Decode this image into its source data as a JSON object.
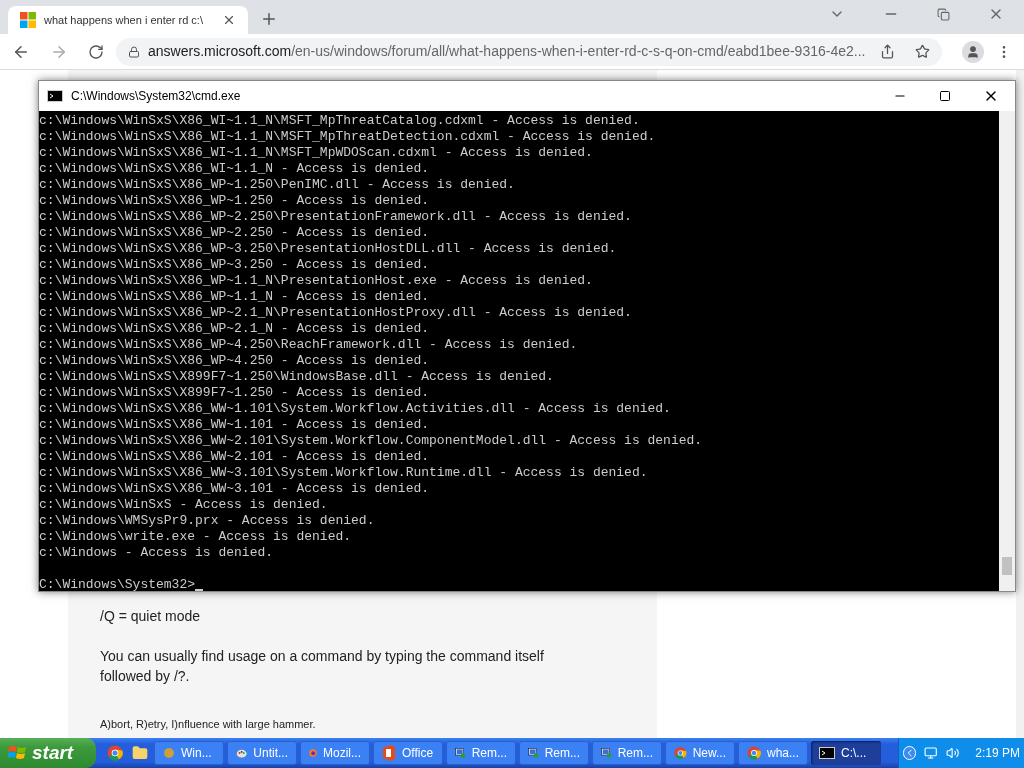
{
  "browser": {
    "tab_title": "what happens when i enter rd c:\\",
    "url_host": "answers.microsoft.com",
    "url_path": "/en-us/windows/forum/all/what-happens-when-i-enter-rd-c-s-q-on-cmd/eabd1bee-9316-4e2..."
  },
  "page": {
    "lines": [
      "/Q = quiet mode",
      "You can usually find usage on a command by typing the command itself followed by /?."
    ],
    "signature": "A)bort, R)etry, I)nfluence with large hammer."
  },
  "cmd": {
    "title": "C:\\Windows\\System32\\cmd.exe",
    "lines": [
      "c:\\Windows\\WinSxS\\X86_WI~1.1_N\\MSFT_MpThreatCatalog.cdxml - Access is denied.",
      "c:\\Windows\\WinSxS\\X86_WI~1.1_N\\MSFT_MpThreatDetection.cdxml - Access is denied.",
      "c:\\Windows\\WinSxS\\X86_WI~1.1_N\\MSFT_MpWDOScan.cdxml - Access is denied.",
      "c:\\Windows\\WinSxS\\X86_WI~1.1_N - Access is denied.",
      "c:\\Windows\\WinSxS\\X86_WP~1.250\\PenIMC.dll - Access is denied.",
      "c:\\Windows\\WinSxS\\X86_WP~1.250 - Access is denied.",
      "c:\\Windows\\WinSxS\\X86_WP~2.250\\PresentationFramework.dll - Access is denied.",
      "c:\\Windows\\WinSxS\\X86_WP~2.250 - Access is denied.",
      "c:\\Windows\\WinSxS\\X86_WP~3.250\\PresentationHostDLL.dll - Access is denied.",
      "c:\\Windows\\WinSxS\\X86_WP~3.250 - Access is denied.",
      "c:\\Windows\\WinSxS\\X86_WP~1.1_N\\PresentationHost.exe - Access is denied.",
      "c:\\Windows\\WinSxS\\X86_WP~1.1_N - Access is denied.",
      "c:\\Windows\\WinSxS\\X86_WP~2.1_N\\PresentationHostProxy.dll - Access is denied.",
      "c:\\Windows\\WinSxS\\X86_WP~2.1_N - Access is denied.",
      "c:\\Windows\\WinSxS\\X86_WP~4.250\\ReachFramework.dll - Access is denied.",
      "c:\\Windows\\WinSxS\\X86_WP~4.250 - Access is denied.",
      "c:\\Windows\\WinSxS\\X899F7~1.250\\WindowsBase.dll - Access is denied.",
      "c:\\Windows\\WinSxS\\X899F7~1.250 - Access is denied.",
      "c:\\Windows\\WinSxS\\X86_WW~1.101\\System.Workflow.Activities.dll - Access is denied.",
      "c:\\Windows\\WinSxS\\X86_WW~1.101 - Access is denied.",
      "c:\\Windows\\WinSxS\\X86_WW~2.101\\System.Workflow.ComponentModel.dll - Access is denied.",
      "c:\\Windows\\WinSxS\\X86_WW~2.101 - Access is denied.",
      "c:\\Windows\\WinSxS\\X86_WW~3.101\\System.Workflow.Runtime.dll - Access is denied.",
      "c:\\Windows\\WinSxS\\X86_WW~3.101 - Access is denied.",
      "c:\\Windows\\WinSxS - Access is denied.",
      "c:\\Windows\\WMSysPr9.prx - Access is denied.",
      "c:\\Windows\\write.exe - Access is denied.",
      "c:\\Windows - Access is denied."
    ],
    "prompt": "C:\\Windows\\System32>"
  },
  "taskbar": {
    "start": "start",
    "items": [
      {
        "kind": "chrome",
        "selected": false
      },
      {
        "kind": "folder",
        "selected": false
      },
      {
        "kind": "dot",
        "label": "Win...",
        "selected": false
      },
      {
        "kind": "paint",
        "label": "Untit...",
        "selected": false
      },
      {
        "kind": "firefox",
        "label": "Mozil...",
        "selected": false
      },
      {
        "kind": "office",
        "label": "Office",
        "selected": false
      },
      {
        "kind": "remote",
        "label": "Rem...",
        "selected": false
      },
      {
        "kind": "remote",
        "label": "Rem...",
        "selected": false
      },
      {
        "kind": "remote",
        "label": "Rem...",
        "selected": false
      },
      {
        "kind": "chrome",
        "label": "New...",
        "selected": false
      },
      {
        "kind": "chrome",
        "label": "wha...",
        "selected": false
      },
      {
        "kind": "cmd",
        "label": "C:\\...",
        "selected": true
      }
    ],
    "clock": "2:19 PM"
  }
}
